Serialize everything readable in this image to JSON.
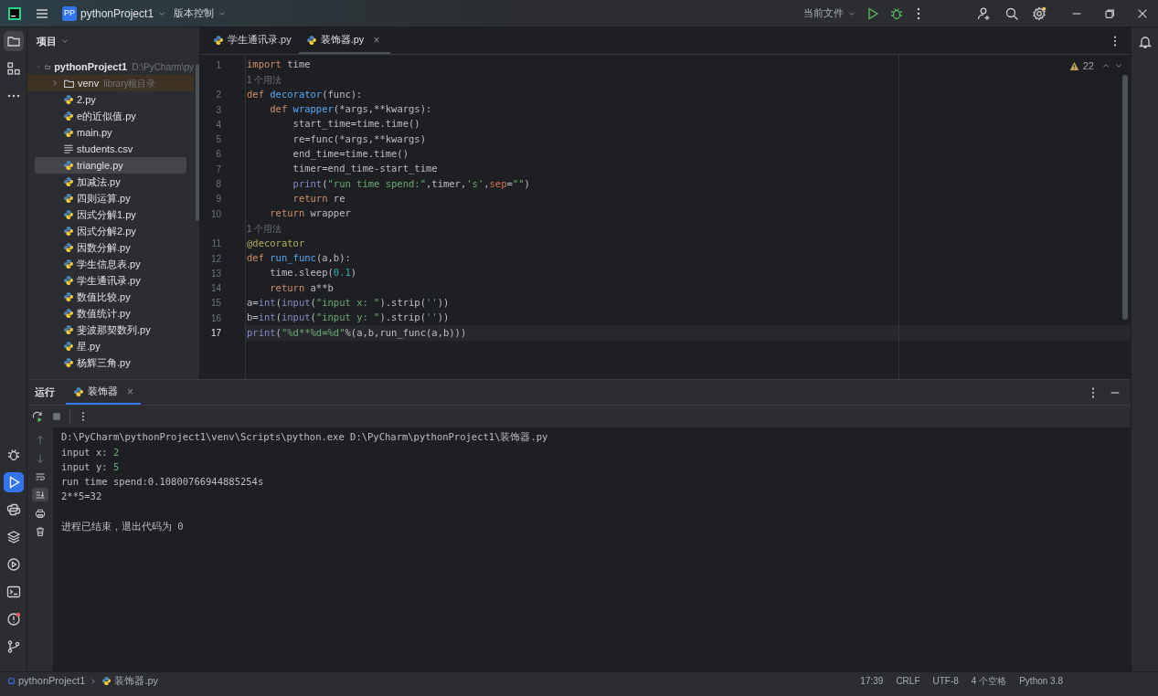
{
  "title_bar": {
    "project_badge": "PP",
    "project": "pythonProject1",
    "vcs": "版本控制",
    "run_config": "当前文件"
  },
  "left_tools_top": [
    {
      "selected": true
    },
    {
      "selected": false
    },
    {
      "selected": false
    }
  ],
  "left_tools_bottom": [
    {
      "selected": false
    },
    {
      "selected": true
    },
    {
      "selected": false
    },
    {
      "selected": false
    },
    {
      "selected": false
    },
    {
      "selected": false
    },
    {
      "selected": false
    },
    {
      "selected": false
    }
  ],
  "project_panel": {
    "title": "项目",
    "root": {
      "label": "pythonProject1",
      "path": "D:\\PyCharm\\py",
      "expanded": true,
      "children": [
        {
          "label": "venv",
          "note": "library根目录",
          "kind": "folder",
          "expanded": false,
          "selected": false
        },
        {
          "label": "2.py",
          "kind": "py",
          "selected": false
        },
        {
          "label": "e的近似值.py",
          "kind": "py",
          "selected": false
        },
        {
          "label": "main.py",
          "kind": "py",
          "selected": false
        },
        {
          "label": "students.csv",
          "kind": "text",
          "selected": false
        },
        {
          "label": "triangle.py",
          "kind": "py",
          "selected": true
        },
        {
          "label": "加减法.py",
          "kind": "py",
          "selected": false
        },
        {
          "label": "四则运算.py",
          "kind": "py",
          "selected": false
        },
        {
          "label": "因式分解1.py",
          "kind": "py",
          "selected": false
        },
        {
          "label": "因式分解2.py",
          "kind": "py",
          "selected": false
        },
        {
          "label": "因数分解.py",
          "kind": "py",
          "selected": false
        },
        {
          "label": "学生信息表.py",
          "kind": "py",
          "selected": false
        },
        {
          "label": "学生通讯录.py",
          "kind": "py",
          "selected": false
        },
        {
          "label": "数值比较.py",
          "kind": "py",
          "selected": false
        },
        {
          "label": "数值统计.py",
          "kind": "py",
          "selected": false
        },
        {
          "label": "斐波那契数列.py",
          "kind": "py",
          "selected": false
        },
        {
          "label": "星.py",
          "kind": "py",
          "selected": false
        },
        {
          "label": "杨辉三角.py",
          "kind": "py",
          "selected": false
        }
      ]
    }
  },
  "editor_tabs": [
    {
      "label": "学生通讯录.py",
      "selected": false
    },
    {
      "label": "装饰器.py",
      "selected": true,
      "close": "×"
    }
  ],
  "warnings": "22",
  "code": [
    {
      "kind": "line",
      "number": "1",
      "current": false,
      "tokens": [
        {
          "text": "import",
          "kind": "keyword"
        },
        {
          "text": " time",
          "kind": "plain"
        }
      ]
    },
    {
      "kind": "hint",
      "text": "1 个用法"
    },
    {
      "kind": "line",
      "number": "2",
      "current": false,
      "tokens": [
        {
          "text": "def",
          "kind": "keyword"
        },
        {
          "text": " decorator",
          "kind": "function"
        },
        {
          "text": "(func):",
          "kind": "plain"
        }
      ]
    },
    {
      "kind": "line",
      "number": "3",
      "current": false,
      "tokens": [
        {
          "text": "    def",
          "kind": "keyword"
        },
        {
          "text": " wrapper",
          "kind": "function"
        },
        {
          "text": "(*args,**kwargs):",
          "kind": "plain"
        }
      ]
    },
    {
      "kind": "line",
      "number": "4",
      "current": false,
      "tokens": [
        {
          "text": "        start_time=time.time()",
          "kind": "plain"
        }
      ]
    },
    {
      "kind": "line",
      "number": "5",
      "current": false,
      "tokens": [
        {
          "text": "        re=func(*args,**kwargs)",
          "kind": "plain"
        }
      ]
    },
    {
      "kind": "line",
      "number": "6",
      "current": false,
      "tokens": [
        {
          "text": "        end_time=time.time()",
          "kind": "plain"
        }
      ]
    },
    {
      "kind": "line",
      "number": "7",
      "current": false,
      "tokens": [
        {
          "text": "        timer=end_time-start_time",
          "kind": "plain"
        }
      ]
    },
    {
      "kind": "line",
      "number": "8",
      "current": false,
      "tokens": [
        {
          "text": "        print",
          "kind": "builtin"
        },
        {
          "text": "(",
          "kind": "plain"
        },
        {
          "text": "\"run time spend:\"",
          "kind": "string"
        },
        {
          "text": ",timer,",
          "kind": "plain"
        },
        {
          "text": "'s'",
          "kind": "string"
        },
        {
          "text": ",",
          "kind": "plain"
        },
        {
          "text": "sep",
          "kind": "param"
        },
        {
          "text": "=",
          "kind": "plain"
        },
        {
          "text": "\"\"",
          "kind": "string"
        },
        {
          "text": ")",
          "kind": "plain"
        }
      ]
    },
    {
      "kind": "line",
      "number": "9",
      "current": false,
      "tokens": [
        {
          "text": "        return",
          "kind": "keyword"
        },
        {
          "text": " re",
          "kind": "plain"
        }
      ]
    },
    {
      "kind": "line",
      "number": "10",
      "current": false,
      "tokens": [
        {
          "text": "    return",
          "kind": "keyword"
        },
        {
          "text": " wrapper",
          "kind": "plain"
        }
      ]
    },
    {
      "kind": "hint",
      "text": "1 个用法"
    },
    {
      "kind": "line",
      "number": "11",
      "current": false,
      "tokens": [
        {
          "text": "@decorator",
          "kind": "decorator"
        }
      ]
    },
    {
      "kind": "line",
      "number": "12",
      "current": false,
      "tokens": [
        {
          "text": "def",
          "kind": "keyword"
        },
        {
          "text": " run_func",
          "kind": "function"
        },
        {
          "text": "(a,b):",
          "kind": "plain"
        }
      ]
    },
    {
      "kind": "line",
      "number": "13",
      "current": false,
      "tokens": [
        {
          "text": "    time.sleep(",
          "kind": "plain"
        },
        {
          "text": "0.1",
          "kind": "number"
        },
        {
          "text": ")",
          "kind": "plain"
        }
      ]
    },
    {
      "kind": "line",
      "number": "14",
      "current": false,
      "tokens": [
        {
          "text": "    return",
          "kind": "keyword"
        },
        {
          "text": " a**b",
          "kind": "plain"
        }
      ]
    },
    {
      "kind": "line",
      "number": "15",
      "current": false,
      "tokens": [
        {
          "text": "a=",
          "kind": "plain"
        },
        {
          "text": "int",
          "kind": "builtin"
        },
        {
          "text": "(",
          "kind": "plain"
        },
        {
          "text": "input",
          "kind": "builtin"
        },
        {
          "text": "(",
          "kind": "plain"
        },
        {
          "text": "\"input x: \"",
          "kind": "string"
        },
        {
          "text": ").strip(",
          "kind": "plain"
        },
        {
          "text": "''",
          "kind": "string"
        },
        {
          "text": "))",
          "kind": "plain"
        }
      ]
    },
    {
      "kind": "line",
      "number": "16",
      "current": false,
      "tokens": [
        {
          "text": "b=",
          "kind": "plain"
        },
        {
          "text": "int",
          "kind": "builtin"
        },
        {
          "text": "(",
          "kind": "plain"
        },
        {
          "text": "input",
          "kind": "builtin"
        },
        {
          "text": "(",
          "kind": "plain"
        },
        {
          "text": "\"input y: \"",
          "kind": "string"
        },
        {
          "text": ").strip(",
          "kind": "plain"
        },
        {
          "text": "''",
          "kind": "string"
        },
        {
          "text": "))",
          "kind": "plain"
        }
      ]
    },
    {
      "kind": "line",
      "number": "17",
      "current": true,
      "tokens": [
        {
          "text": "print",
          "kind": "builtin"
        },
        {
          "text": "(",
          "kind": "plain"
        },
        {
          "text": "\"%d**%d=%d\"",
          "kind": "string"
        },
        {
          "text": "%(a,b,run_func(a,b)))",
          "kind": "plain"
        }
      ]
    }
  ],
  "run_panel": {
    "title": "运行",
    "tab": {
      "label": "装饰器",
      "close": "×"
    },
    "output": [
      {
        "kind": "plain",
        "text": "D:\\PyCharm\\pythonProject1\\venv\\Scripts\\python.exe D:\\PyCharm\\pythonProject1\\装饰器.py"
      },
      {
        "kind": "input",
        "text": "input x: ",
        "value": "2"
      },
      {
        "kind": "input",
        "text": "input y: ",
        "value": "5"
      },
      {
        "kind": "plain",
        "text": "run time spend:0.10800766944885254s"
      },
      {
        "kind": "plain",
        "text": "2**5=32"
      },
      {
        "kind": "blank"
      },
      {
        "kind": "plain",
        "text": "进程已结束，退出代码为 0"
      }
    ]
  },
  "status_bar": {
    "breadcrumb": [
      "pythonProject1",
      "装饰器.py"
    ],
    "items": [
      "17:39",
      "CRLF",
      "UTF-8",
      "4 个空格",
      "Python 3.8"
    ]
  }
}
